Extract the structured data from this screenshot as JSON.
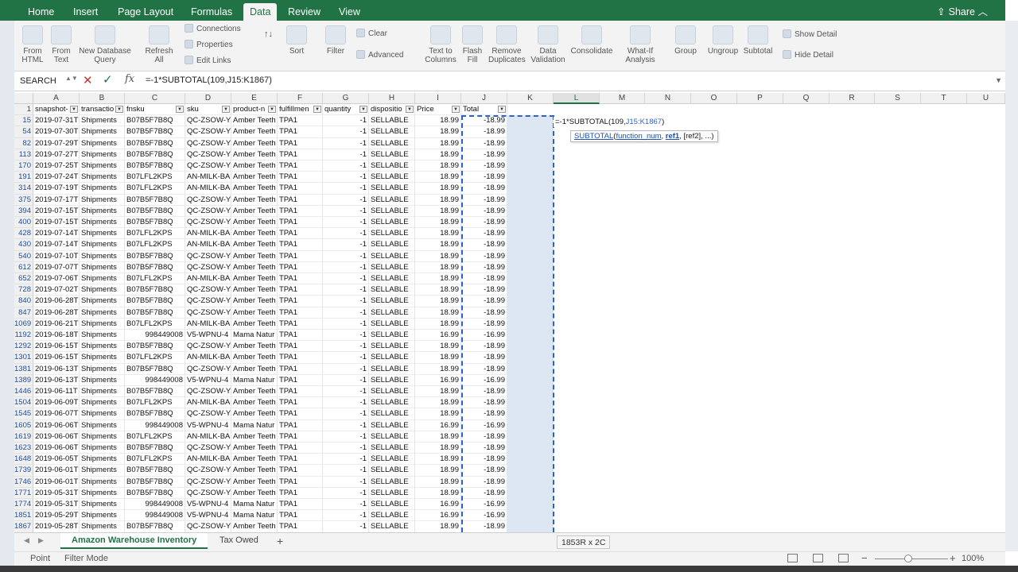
{
  "ribbon_tabs": [
    "Home",
    "Insert",
    "Page Layout",
    "Formulas",
    "Data",
    "Review",
    "View"
  ],
  "active_tab": "Data",
  "share_label": "Share",
  "ribbon": {
    "from_html": "From\nHTML",
    "from_text": "From\nText",
    "new_db_query": "New Database\nQuery",
    "refresh_all": "Refresh\nAll",
    "connections": "Connections",
    "properties": "Properties",
    "edit_links": "Edit Links",
    "sort": "Sort",
    "filter": "Filter",
    "clear": "Clear",
    "advanced": "Advanced",
    "text_to_columns": "Text to\nColumns",
    "flash_fill": "Flash\nFill",
    "remove_duplicates": "Remove\nDuplicates",
    "data_validation": "Data\nValidation",
    "consolidate": "Consolidate",
    "what_if": "What-If\nAnalysis",
    "group": "Group",
    "ungroup": "Ungroup",
    "subtotal": "Subtotal",
    "show_detail": "Show Detail",
    "hide_detail": "Hide Detail"
  },
  "formula_bar": {
    "name_box": "SEARCH",
    "formula": "=-1*SUBTOTAL(109,J15:K1867)"
  },
  "columns": [
    "A",
    "B",
    "C",
    "D",
    "E",
    "F",
    "G",
    "H",
    "I",
    "J",
    "K",
    "L",
    "M",
    "N",
    "O",
    "P",
    "Q",
    "R",
    "S",
    "T",
    "U"
  ],
  "selected_column": "L",
  "header_row": {
    "row": "1",
    "cells": [
      "snapshot-",
      "transactio",
      "fnsku",
      "sku",
      "product-n",
      "fulfillmen",
      "quantity",
      "dispositio",
      "Price",
      "Total"
    ]
  },
  "rows": [
    {
      "row": "15",
      "date": "2019-07-31T",
      "txn": "Shipments",
      "fnsku": "B07B5F7B8Q",
      "sku": "QC-ZSOW-Y",
      "product": "Amber Teeth",
      "fc": "TPA1",
      "qty": "-1",
      "disp": "SELLABLE",
      "price": "18.99",
      "total": "-18.99"
    },
    {
      "row": "54",
      "date": "2019-07-30T",
      "txn": "Shipments",
      "fnsku": "B07B5F7B8Q",
      "sku": "QC-ZSOW-Y",
      "product": "Amber Teeth",
      "fc": "TPA1",
      "qty": "-1",
      "disp": "SELLABLE",
      "price": "18.99",
      "total": "-18.99"
    },
    {
      "row": "82",
      "date": "2019-07-29T",
      "txn": "Shipments",
      "fnsku": "B07B5F7B8Q",
      "sku": "QC-ZSOW-Y",
      "product": "Amber Teeth",
      "fc": "TPA1",
      "qty": "-1",
      "disp": "SELLABLE",
      "price": "18.99",
      "total": "-18.99"
    },
    {
      "row": "113",
      "date": "2019-07-27T",
      "txn": "Shipments",
      "fnsku": "B07B5F7B8Q",
      "sku": "QC-ZSOW-Y",
      "product": "Amber Teeth",
      "fc": "TPA1",
      "qty": "-1",
      "disp": "SELLABLE",
      "price": "18.99",
      "total": "-18.99"
    },
    {
      "row": "170",
      "date": "2019-07-25T",
      "txn": "Shipments",
      "fnsku": "B07B5F7B8Q",
      "sku": "QC-ZSOW-Y",
      "product": "Amber Teeth",
      "fc": "TPA1",
      "qty": "-1",
      "disp": "SELLABLE",
      "price": "18.99",
      "total": "-18.99"
    },
    {
      "row": "191",
      "date": "2019-07-24T",
      "txn": "Shipments",
      "fnsku": "B07LFL2KPS",
      "sku": "AN-MILK-BA",
      "product": "Amber Teeth",
      "fc": "TPA1",
      "qty": "-1",
      "disp": "SELLABLE",
      "price": "18.99",
      "total": "-18.99"
    },
    {
      "row": "314",
      "date": "2019-07-19T",
      "txn": "Shipments",
      "fnsku": "B07LFL2KPS",
      "sku": "AN-MILK-BA",
      "product": "Amber Teeth",
      "fc": "TPA1",
      "qty": "-1",
      "disp": "SELLABLE",
      "price": "18.99",
      "total": "-18.99"
    },
    {
      "row": "375",
      "date": "2019-07-17T",
      "txn": "Shipments",
      "fnsku": "B07B5F7B8Q",
      "sku": "QC-ZSOW-Y",
      "product": "Amber Teeth",
      "fc": "TPA1",
      "qty": "-1",
      "disp": "SELLABLE",
      "price": "18.99",
      "total": "-18.99"
    },
    {
      "row": "394",
      "date": "2019-07-15T",
      "txn": "Shipments",
      "fnsku": "B07B5F7B8Q",
      "sku": "QC-ZSOW-Y",
      "product": "Amber Teeth",
      "fc": "TPA1",
      "qty": "-1",
      "disp": "SELLABLE",
      "price": "18.99",
      "total": "-18.99"
    },
    {
      "row": "400",
      "date": "2019-07-15T",
      "txn": "Shipments",
      "fnsku": "B07B5F7B8Q",
      "sku": "QC-ZSOW-Y",
      "product": "Amber Teeth",
      "fc": "TPA1",
      "qty": "-1",
      "disp": "SELLABLE",
      "price": "18.99",
      "total": "-18.99"
    },
    {
      "row": "428",
      "date": "2019-07-14T",
      "txn": "Shipments",
      "fnsku": "B07LFL2KPS",
      "sku": "AN-MILK-BA",
      "product": "Amber Teeth",
      "fc": "TPA1",
      "qty": "-1",
      "disp": "SELLABLE",
      "price": "18.99",
      "total": "-18.99"
    },
    {
      "row": "430",
      "date": "2019-07-14T",
      "txn": "Shipments",
      "fnsku": "B07LFL2KPS",
      "sku": "AN-MILK-BA",
      "product": "Amber Teeth",
      "fc": "TPA1",
      "qty": "-1",
      "disp": "SELLABLE",
      "price": "18.99",
      "total": "-18.99"
    },
    {
      "row": "540",
      "date": "2019-07-10T",
      "txn": "Shipments",
      "fnsku": "B07B5F7B8Q",
      "sku": "QC-ZSOW-Y",
      "product": "Amber Teeth",
      "fc": "TPA1",
      "qty": "-1",
      "disp": "SELLABLE",
      "price": "18.99",
      "total": "-18.99"
    },
    {
      "row": "612",
      "date": "2019-07-07T",
      "txn": "Shipments",
      "fnsku": "B07B5F7B8Q",
      "sku": "QC-ZSOW-Y",
      "product": "Amber Teeth",
      "fc": "TPA1",
      "qty": "-1",
      "disp": "SELLABLE",
      "price": "18.99",
      "total": "-18.99"
    },
    {
      "row": "652",
      "date": "2019-07-06T",
      "txn": "Shipments",
      "fnsku": "B07LFL2KPS",
      "sku": "AN-MILK-BA",
      "product": "Amber Teeth",
      "fc": "TPA1",
      "qty": "-1",
      "disp": "SELLABLE",
      "price": "18.99",
      "total": "-18.99"
    },
    {
      "row": "728",
      "date": "2019-07-02T",
      "txn": "Shipments",
      "fnsku": "B07B5F7B8Q",
      "sku": "QC-ZSOW-Y",
      "product": "Amber Teeth",
      "fc": "TPA1",
      "qty": "-1",
      "disp": "SELLABLE",
      "price": "18.99",
      "total": "-18.99"
    },
    {
      "row": "840",
      "date": "2019-06-28T",
      "txn": "Shipments",
      "fnsku": "B07B5F7B8Q",
      "sku": "QC-ZSOW-Y",
      "product": "Amber Teeth",
      "fc": "TPA1",
      "qty": "-1",
      "disp": "SELLABLE",
      "price": "18.99",
      "total": "-18.99"
    },
    {
      "row": "847",
      "date": "2019-06-28T",
      "txn": "Shipments",
      "fnsku": "B07B5F7B8Q",
      "sku": "QC-ZSOW-Y",
      "product": "Amber Teeth",
      "fc": "TPA1",
      "qty": "-1",
      "disp": "SELLABLE",
      "price": "18.99",
      "total": "-18.99"
    },
    {
      "row": "1069",
      "date": "2019-06-21T",
      "txn": "Shipments",
      "fnsku": "B07LFL2KPS",
      "sku": "AN-MILK-BA",
      "product": "Amber Teeth",
      "fc": "TPA1",
      "qty": "-1",
      "disp": "SELLABLE",
      "price": "18.99",
      "total": "-18.99"
    },
    {
      "row": "1192",
      "date": "2019-06-18T",
      "txn": "Shipments",
      "fnsku": "998449008",
      "sku": "V5-WPNU-4",
      "product": "Mama Natur",
      "fc": "TPA1",
      "qty": "-1",
      "disp": "SELLABLE",
      "price": "16.99",
      "total": "-16.99"
    },
    {
      "row": "1292",
      "date": "2019-06-15T",
      "txn": "Shipments",
      "fnsku": "B07B5F7B8Q",
      "sku": "QC-ZSOW-Y",
      "product": "Amber Teeth",
      "fc": "TPA1",
      "qty": "-1",
      "disp": "SELLABLE",
      "price": "18.99",
      "total": "-18.99"
    },
    {
      "row": "1301",
      "date": "2019-06-15T",
      "txn": "Shipments",
      "fnsku": "B07LFL2KPS",
      "sku": "AN-MILK-BA",
      "product": "Amber Teeth",
      "fc": "TPA1",
      "qty": "-1",
      "disp": "SELLABLE",
      "price": "18.99",
      "total": "-18.99"
    },
    {
      "row": "1381",
      "date": "2019-06-13T",
      "txn": "Shipments",
      "fnsku": "B07B5F7B8Q",
      "sku": "QC-ZSOW-Y",
      "product": "Amber Teeth",
      "fc": "TPA1",
      "qty": "-1",
      "disp": "SELLABLE",
      "price": "18.99",
      "total": "-18.99"
    },
    {
      "row": "1389",
      "date": "2019-06-13T",
      "txn": "Shipments",
      "fnsku": "998449008",
      "sku": "V5-WPNU-4",
      "product": "Mama Natur",
      "fc": "TPA1",
      "qty": "-1",
      "disp": "SELLABLE",
      "price": "16.99",
      "total": "-16.99"
    },
    {
      "row": "1446",
      "date": "2019-06-11T",
      "txn": "Shipments",
      "fnsku": "B07B5F7B8Q",
      "sku": "QC-ZSOW-Y",
      "product": "Amber Teeth",
      "fc": "TPA1",
      "qty": "-1",
      "disp": "SELLABLE",
      "price": "18.99",
      "total": "-18.99"
    },
    {
      "row": "1504",
      "date": "2019-06-09T",
      "txn": "Shipments",
      "fnsku": "B07LFL2KPS",
      "sku": "AN-MILK-BA",
      "product": "Amber Teeth",
      "fc": "TPA1",
      "qty": "-1",
      "disp": "SELLABLE",
      "price": "18.99",
      "total": "-18.99"
    },
    {
      "row": "1545",
      "date": "2019-06-07T",
      "txn": "Shipments",
      "fnsku": "B07B5F7B8Q",
      "sku": "QC-ZSOW-Y",
      "product": "Amber Teeth",
      "fc": "TPA1",
      "qty": "-1",
      "disp": "SELLABLE",
      "price": "18.99",
      "total": "-18.99"
    },
    {
      "row": "1605",
      "date": "2019-06-06T",
      "txn": "Shipments",
      "fnsku": "998449008",
      "sku": "V5-WPNU-4",
      "product": "Mama Natur",
      "fc": "TPA1",
      "qty": "-1",
      "disp": "SELLABLE",
      "price": "16.99",
      "total": "-16.99"
    },
    {
      "row": "1619",
      "date": "2019-06-06T",
      "txn": "Shipments",
      "fnsku": "B07LFL2KPS",
      "sku": "AN-MILK-BA",
      "product": "Amber Teeth",
      "fc": "TPA1",
      "qty": "-1",
      "disp": "SELLABLE",
      "price": "18.99",
      "total": "-18.99"
    },
    {
      "row": "1623",
      "date": "2019-06-06T",
      "txn": "Shipments",
      "fnsku": "B07B5F7B8Q",
      "sku": "QC-ZSOW-Y",
      "product": "Amber Teeth",
      "fc": "TPA1",
      "qty": "-1",
      "disp": "SELLABLE",
      "price": "18.99",
      "total": "-18.99"
    },
    {
      "row": "1648",
      "date": "2019-06-05T",
      "txn": "Shipments",
      "fnsku": "B07LFL2KPS",
      "sku": "AN-MILK-BA",
      "product": "Amber Teeth",
      "fc": "TPA1",
      "qty": "-1",
      "disp": "SELLABLE",
      "price": "18.99",
      "total": "-18.99"
    },
    {
      "row": "1739",
      "date": "2019-06-01T",
      "txn": "Shipments",
      "fnsku": "B07B5F7B8Q",
      "sku": "QC-ZSOW-Y",
      "product": "Amber Teeth",
      "fc": "TPA1",
      "qty": "-1",
      "disp": "SELLABLE",
      "price": "18.99",
      "total": "-18.99"
    },
    {
      "row": "1746",
      "date": "2019-06-01T",
      "txn": "Shipments",
      "fnsku": "B07B5F7B8Q",
      "sku": "QC-ZSOW-Y",
      "product": "Amber Teeth",
      "fc": "TPA1",
      "qty": "-1",
      "disp": "SELLABLE",
      "price": "18.99",
      "total": "-18.99"
    },
    {
      "row": "1771",
      "date": "2019-05-31T",
      "txn": "Shipments",
      "fnsku": "B07B5F7B8Q",
      "sku": "QC-ZSOW-Y",
      "product": "Amber Teeth",
      "fc": "TPA1",
      "qty": "-1",
      "disp": "SELLABLE",
      "price": "18.99",
      "total": "-18.99"
    },
    {
      "row": "1774",
      "date": "2019-05-31T",
      "txn": "Shipments",
      "fnsku": "998449008",
      "sku": "V5-WPNU-4",
      "product": "Mama Natur",
      "fc": "TPA1",
      "qty": "-1",
      "disp": "SELLABLE",
      "price": "16.99",
      "total": "-16.99"
    },
    {
      "row": "1851",
      "date": "2019-05-29T",
      "txn": "Shipments",
      "fnsku": "998449008",
      "sku": "V5-WPNU-4",
      "product": "Mama Natur",
      "fc": "TPA1",
      "qty": "-1",
      "disp": "SELLABLE",
      "price": "16.99",
      "total": "-16.99"
    },
    {
      "row": "1867",
      "date": "2019-05-28T",
      "txn": "Shipments",
      "fnsku": "B07B5F7B8Q",
      "sku": "QC-ZSOW-Y",
      "product": "Amber Teeth",
      "fc": "TPA1",
      "qty": "-1",
      "disp": "SELLABLE",
      "price": "18.99",
      "total": "-18.99"
    }
  ],
  "edit_cell": {
    "prefix": "=-1*SUBTOTAL(109,",
    "ref": "J15:K1867",
    "suffix": ")"
  },
  "tooltip": {
    "fn": "SUBTOTAL",
    "open": "(",
    "arg1": "function_num",
    "sep1": ", ",
    "arg2": "ref1",
    "rest": ", [ref2], ...)"
  },
  "sheets": [
    "Amazon Warehouse Inventory",
    "Tax Owed"
  ],
  "active_sheet": "Amazon Warehouse Inventory",
  "selection_count": "1853R x 2C",
  "status": {
    "mode": "Point",
    "filter_mode": "Filter Mode",
    "zoom": "100%"
  },
  "colors": {
    "brand_green": "#217346",
    "selection_blue": "#2d63c8",
    "selection_fill": "#dde7f4"
  }
}
